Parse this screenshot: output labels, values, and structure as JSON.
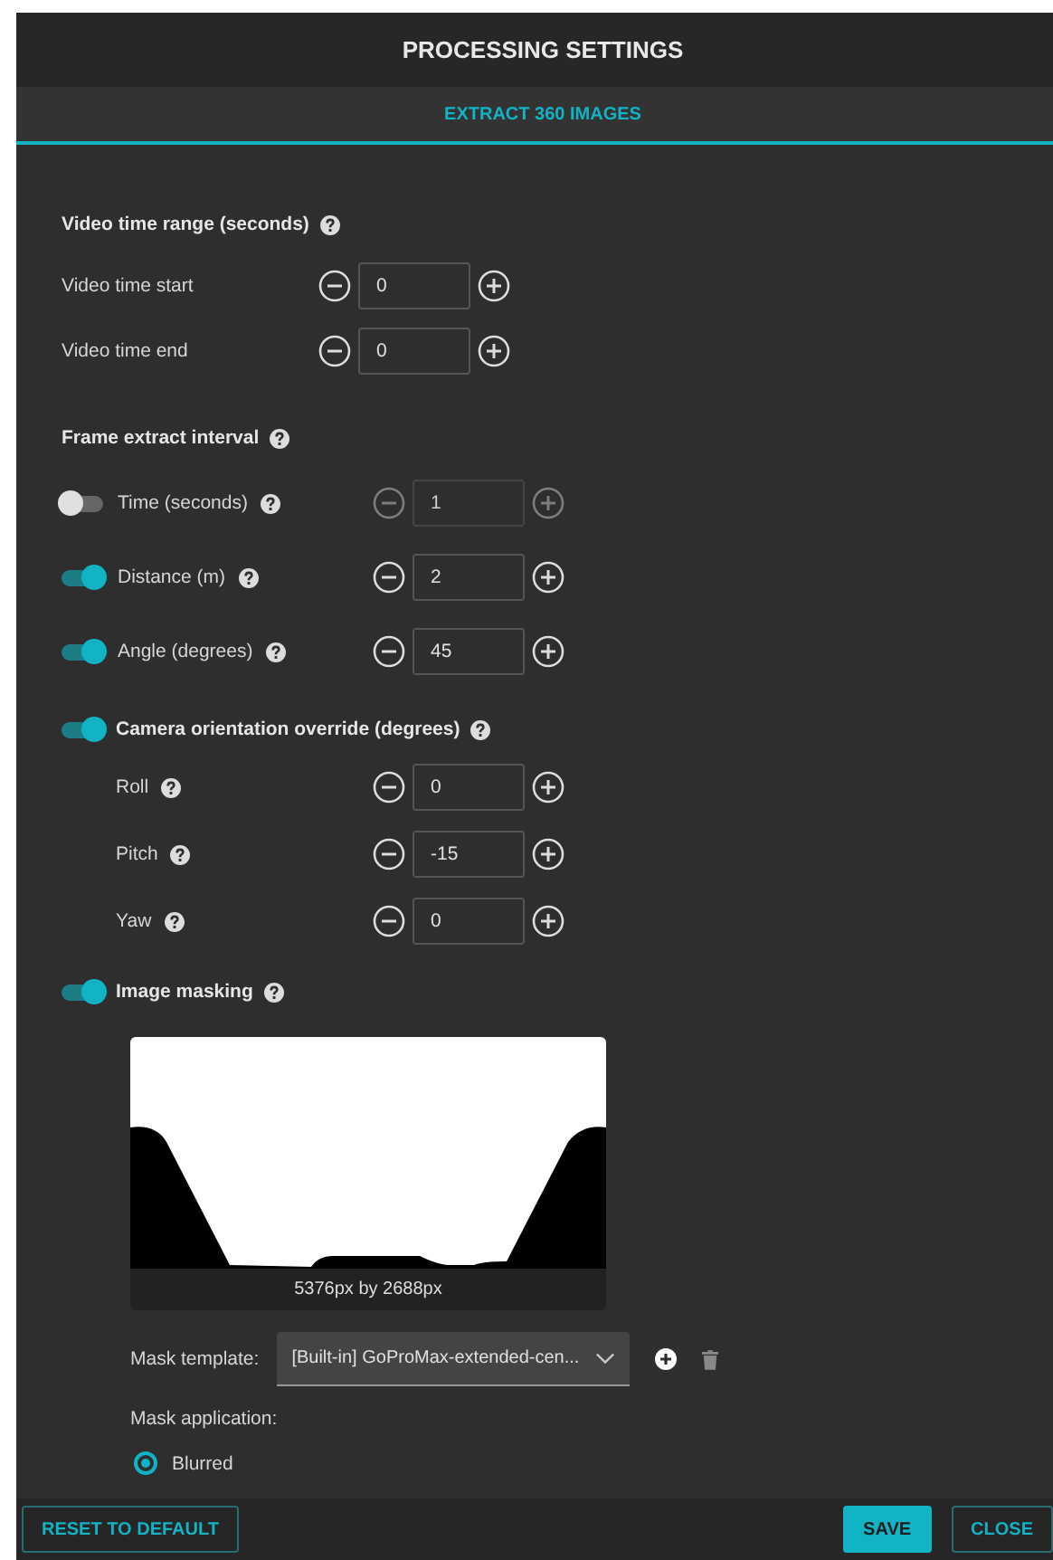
{
  "dialog": {
    "title": "PROCESSING SETTINGS"
  },
  "tabs": [
    {
      "label": "EXTRACT 360 IMAGES",
      "selected": true
    }
  ],
  "video_range": {
    "title": "Video time range (seconds)",
    "rows": [
      {
        "label": "Video time start",
        "value": "0"
      },
      {
        "label": "Video time end",
        "value": "0"
      }
    ]
  },
  "frame_interval": {
    "title": "Frame extract interval",
    "rows": [
      {
        "label": "Time (seconds)",
        "on": false,
        "value": "1"
      },
      {
        "label": "Distance (m)",
        "on": true,
        "value": "2"
      },
      {
        "label": "Angle (degrees)",
        "on": true,
        "value": "45"
      }
    ]
  },
  "camera_override": {
    "title": "Camera orientation override (degrees)",
    "on": true,
    "rows": [
      {
        "label": "Roll",
        "value": "0"
      },
      {
        "label": "Pitch",
        "value": "-15"
      },
      {
        "label": "Yaw",
        "value": "0"
      }
    ]
  },
  "image_masking": {
    "title": "Image masking",
    "on": true,
    "preview": {
      "caption": "5376px by 2688px"
    },
    "template": {
      "label": "Mask template:",
      "value": "[Built-in] GoProMax-extended-cen..."
    },
    "application": {
      "label": "Mask application:",
      "options": [
        {
          "label": "Blurred",
          "selected": true
        }
      ]
    }
  },
  "footer": [
    {
      "label": "RESET TO DEFAULT",
      "kind": "outline"
    },
    {
      "label": "SAVE",
      "kind": "primary"
    },
    {
      "label": "CLOSE",
      "kind": "outline"
    }
  ]
}
